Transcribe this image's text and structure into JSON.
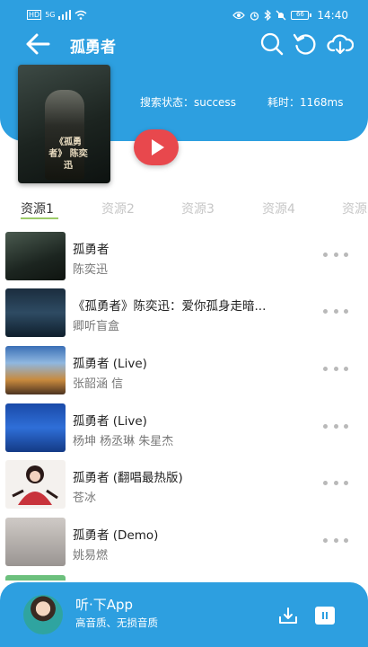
{
  "status_bar": {
    "left_indicators": [
      "HD",
      "5G"
    ],
    "battery": "66",
    "time": "14:40"
  },
  "header": {
    "title": "孤勇者",
    "search_status": "搜索状态：success",
    "search_time": "耗时：1168ms",
    "cover_text": "《孤勇者》 陈奕迅",
    "accent_color": "#2d9fe0"
  },
  "tabs": [
    {
      "label": "资源1",
      "active": true
    },
    {
      "label": "资源2",
      "active": false
    },
    {
      "label": "资源3",
      "active": false
    },
    {
      "label": "资源4",
      "active": false
    },
    {
      "label": "资源",
      "active": false
    }
  ],
  "songs": [
    {
      "title": "孤勇者",
      "artist": "陈奕迅"
    },
    {
      "title": "《孤勇者》陈奕迅：爱你孤身走暗...",
      "artist": "卿听盲盒"
    },
    {
      "title": "孤勇者 (Live)",
      "artist": "张韶涵  信"
    },
    {
      "title": "孤勇者 (Live)",
      "artist": "杨坤  杨丞琳  朱星杰"
    },
    {
      "title": "孤勇者 (翻唱最热版)",
      "artist": "苍冰"
    },
    {
      "title": "孤勇者 (Demo)",
      "artist": "姚易燃"
    }
  ],
  "bottom_bar": {
    "app_name": "听·下App",
    "app_desc": "高音质、无损音质"
  }
}
